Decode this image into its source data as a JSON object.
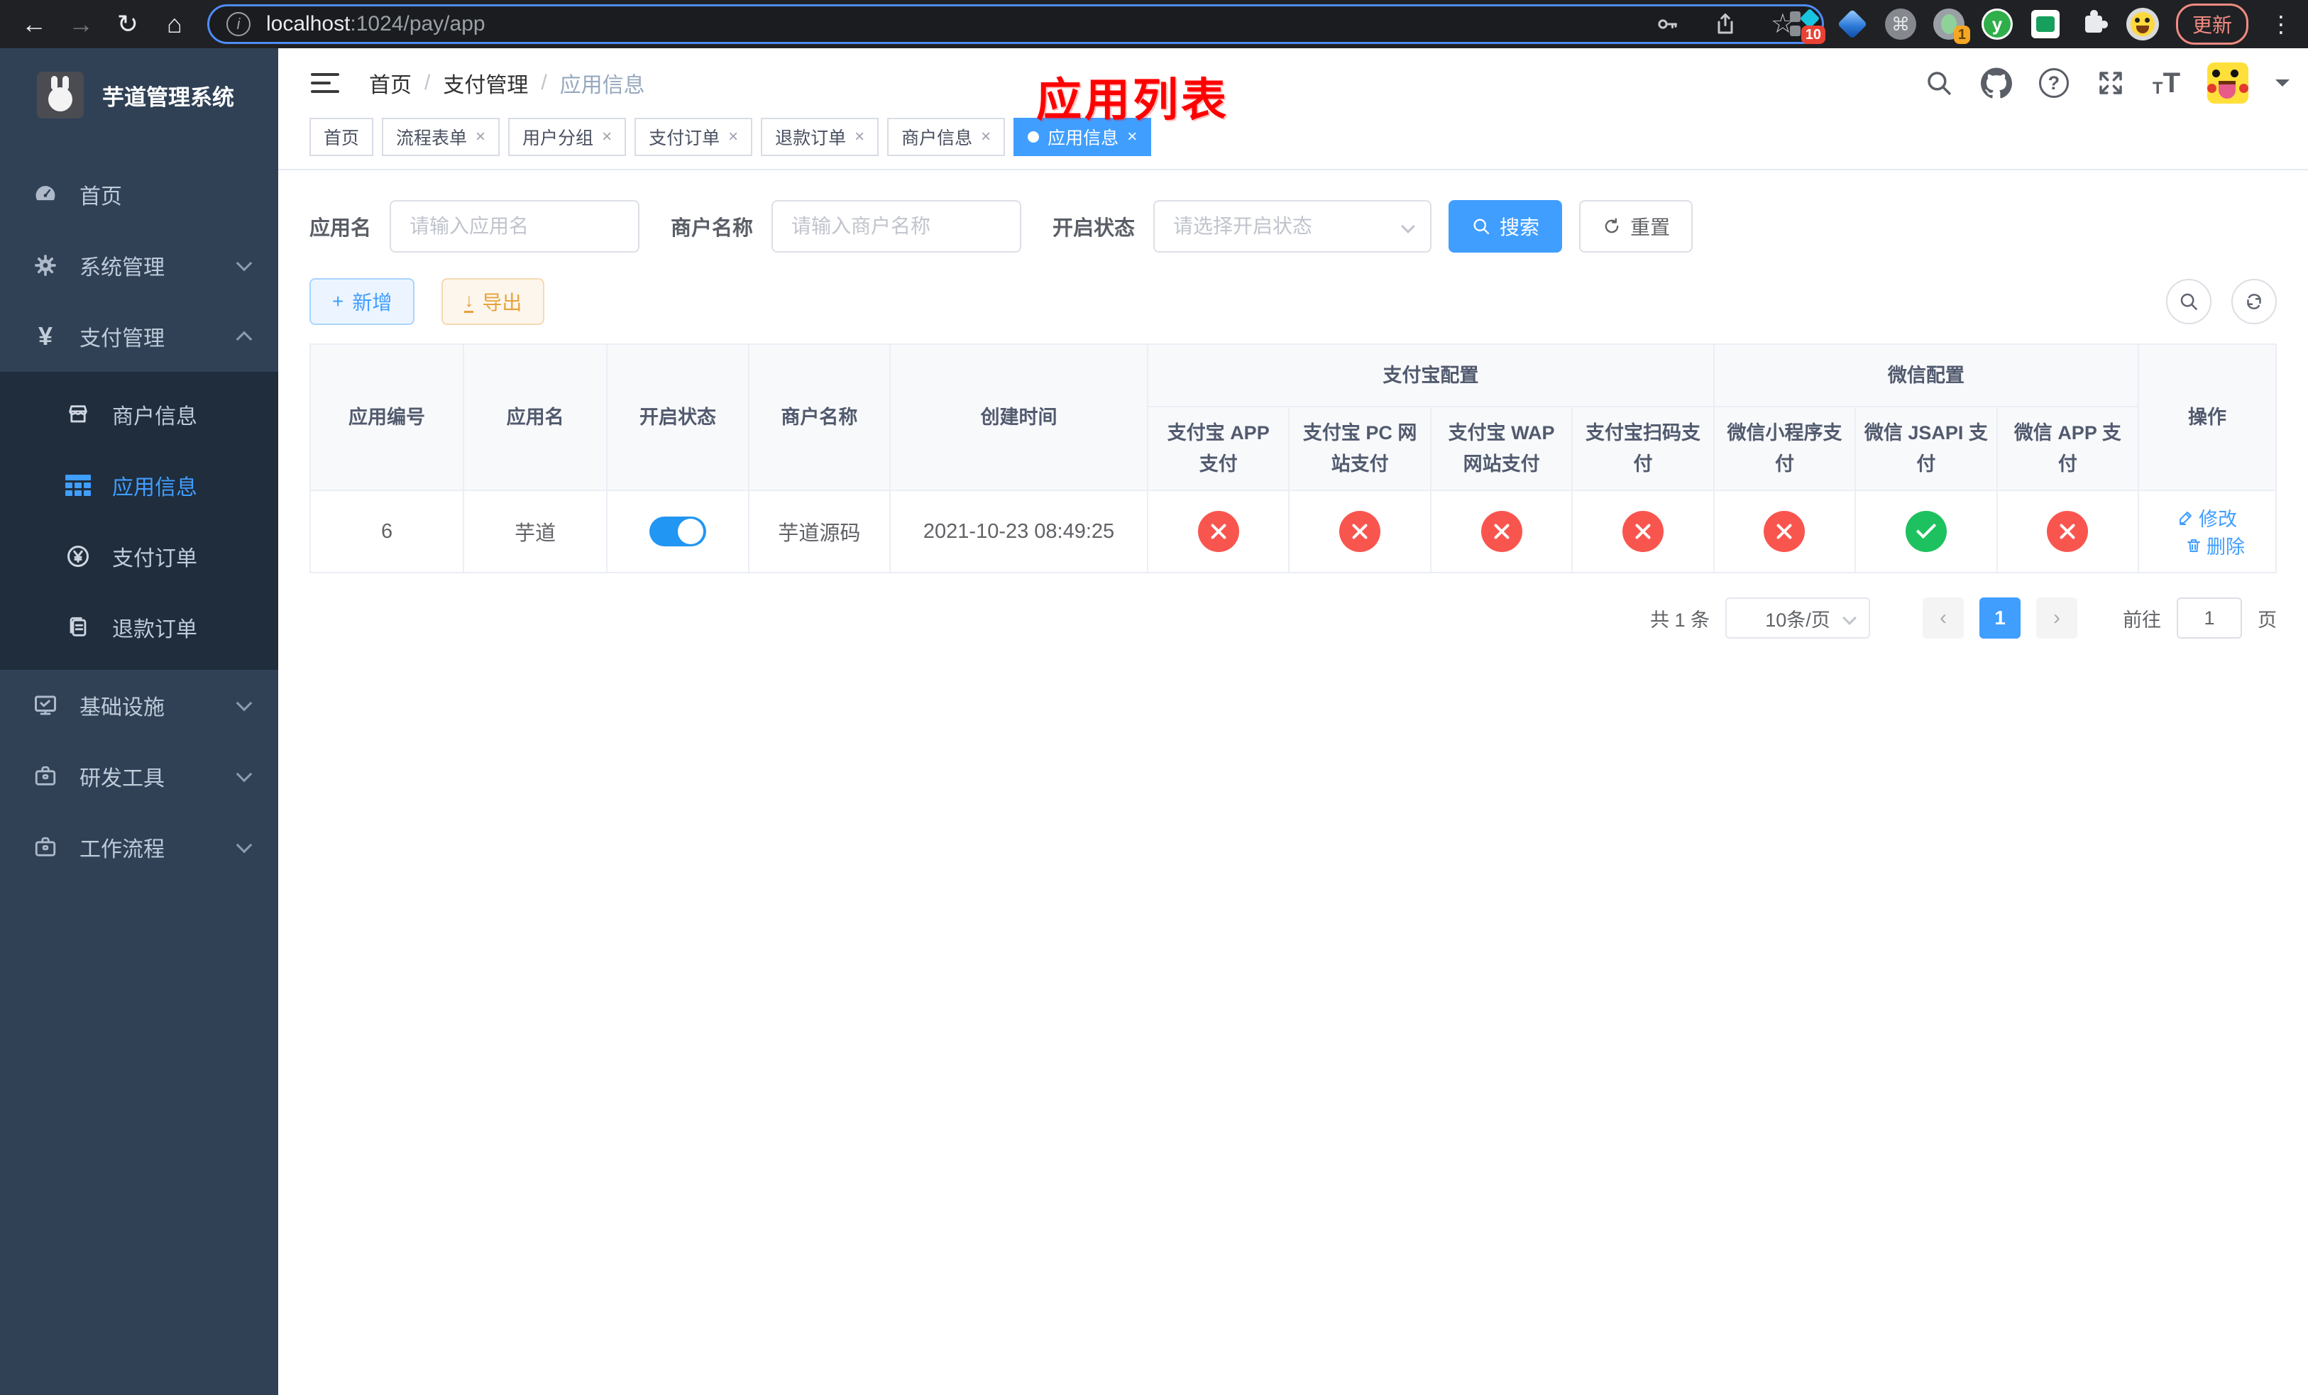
{
  "browser": {
    "url": {
      "host": "localhost",
      "path": ":1024/pay/app"
    },
    "update_label": "更新",
    "ext_badge_10": "10",
    "ext_badge_1": "1",
    "cmd_glyph": "⌘",
    "y_glyph": "y"
  },
  "icons": {
    "back": "←",
    "forward": "→",
    "reload": "↻",
    "home": "⌂",
    "info": "i",
    "star": "☆",
    "dots": "⋮",
    "close": "×",
    "breadcrumb_sep": "/",
    "question": "?",
    "font_small": "T",
    "font_big": "T",
    "yen": "¥",
    "plus": "+",
    "export_arrow": "↓",
    "prev": "‹",
    "next": "›"
  },
  "sidebar": {
    "title": "芋道管理系统",
    "items": [
      {
        "label": "首页"
      },
      {
        "label": "系统管理"
      },
      {
        "label": "支付管理",
        "expanded": true,
        "children": [
          {
            "label": "商户信息"
          },
          {
            "label": "应用信息",
            "active": true
          },
          {
            "label": "支付订单"
          },
          {
            "label": "退款订单"
          }
        ]
      },
      {
        "label": "基础设施"
      },
      {
        "label": "研发工具"
      },
      {
        "label": "工作流程"
      }
    ]
  },
  "header": {
    "breadcrumb": [
      "首页",
      "支付管理",
      "应用信息"
    ],
    "annotation": "应用列表"
  },
  "tabs": [
    {
      "label": "首页",
      "closable": false,
      "active": false
    },
    {
      "label": "流程表单",
      "closable": true,
      "active": false
    },
    {
      "label": "用户分组",
      "closable": true,
      "active": false
    },
    {
      "label": "支付订单",
      "closable": true,
      "active": false
    },
    {
      "label": "退款订单",
      "closable": true,
      "active": false
    },
    {
      "label": "商户信息",
      "closable": true,
      "active": false
    },
    {
      "label": "应用信息",
      "closable": true,
      "active": true
    }
  ],
  "filters": {
    "app_name_label": "应用名",
    "app_name_placeholder": "请输入应用名",
    "merchant_label": "商户名称",
    "merchant_placeholder": "请输入商户名称",
    "status_label": "开启状态",
    "status_placeholder": "请选择开启状态",
    "search_label": "搜索",
    "reset_label": "重置"
  },
  "toolbar": {
    "add_label": "新增",
    "export_label": "导出"
  },
  "table": {
    "group_headers": {
      "alipay": "支付宝配置",
      "wechat": "微信配置"
    },
    "columns": {
      "id": "应用编号",
      "name": "应用名",
      "status": "开启状态",
      "merchant": "商户名称",
      "created": "创建时间",
      "alipay_app": "支付宝 APP 支付",
      "alipay_pc": "支付宝 PC 网站支付",
      "alipay_wap": "支付宝 WAP 网站支付",
      "alipay_qr": "支付宝扫码支付",
      "wx_mini": "微信小程序支付",
      "wx_jsapi": "微信 JSAPI 支付",
      "wx_app": "微信 APP 支付",
      "actions": "操作"
    },
    "rows": [
      {
        "id": "6",
        "name": "芋道",
        "enabled": true,
        "merchant": "芋道源码",
        "created_at": "2021-10-23 08:49:25",
        "channels": [
          "off",
          "off",
          "off",
          "off",
          "off",
          "on",
          "off"
        ],
        "edit_label": "修改",
        "delete_label": "删除"
      }
    ]
  },
  "pagination": {
    "total": "共 1 条",
    "page_size": "10条/页",
    "current_page": "1",
    "goto_label": "前往",
    "goto_value": "1",
    "page_suffix": "页"
  },
  "colors": {
    "accent_blue": "#409eff",
    "toggle_on": "#2196f3",
    "status_off_red": "#f9554f",
    "status_on_green": "#1ec15f",
    "sidebar_bg": "#304156",
    "submenu_bg": "#1f2d3d",
    "annotation_red": "#ff0000"
  }
}
